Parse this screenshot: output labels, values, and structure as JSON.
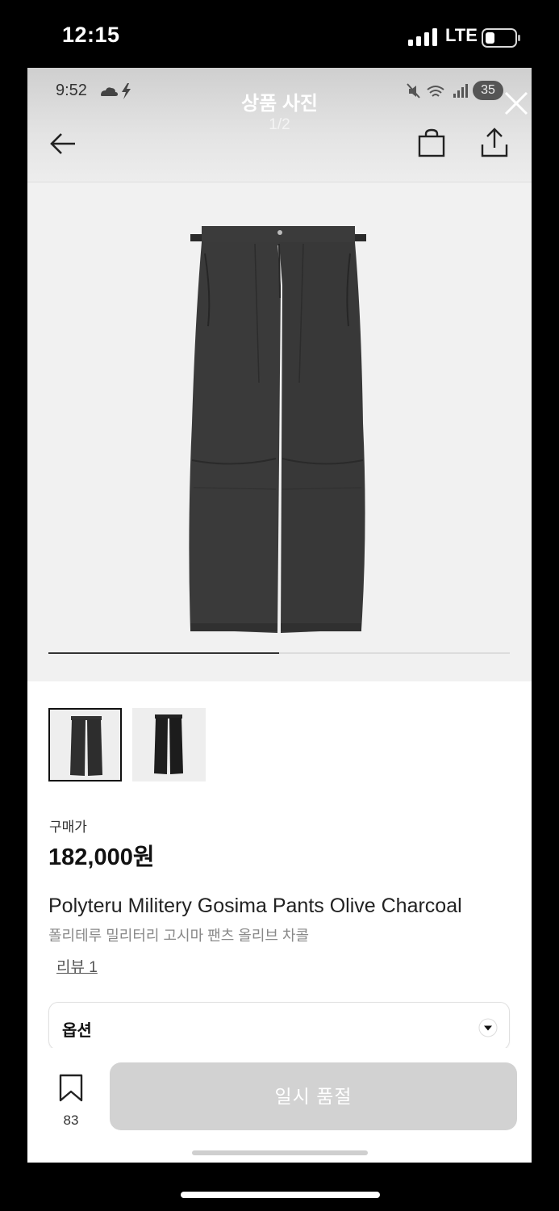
{
  "outer_status": {
    "time": "12:15",
    "network": "LTE",
    "icons": [
      "signal-bars-icon",
      "battery-icon"
    ]
  },
  "inner_status": {
    "time": "9:52",
    "icons": [
      "cloud-icon",
      "bolt-icon",
      "mute-icon",
      "wifi-icon",
      "signal-icon"
    ],
    "battery_badge": "35"
  },
  "header": {
    "title": "상품 사진",
    "counter": "1/2",
    "icons": [
      "close-icon",
      "back-arrow-icon",
      "shopping-bag-icon",
      "share-icon"
    ]
  },
  "gallery": {
    "image_subject": "pants",
    "progress_fraction": 0.5,
    "thumbnails": [
      {
        "selected": true
      },
      {
        "selected": false
      }
    ]
  },
  "product": {
    "price_label": "구매가",
    "price": "182,000원",
    "name_en": "Polyteru Militery Gosima Pants Olive Charcoal",
    "name_ko": "폴리테루 밀리터리 고시마 팬츠 올리브 차콜",
    "review_link": "리뷰 1"
  },
  "option": {
    "label": "옵션"
  },
  "bottom_bar": {
    "wish_count": "83",
    "buy_button": "일시 품절"
  },
  "colors": {
    "button_disabled": "#d2d2d2",
    "text_primary": "#111111",
    "text_secondary": "#888888"
  }
}
